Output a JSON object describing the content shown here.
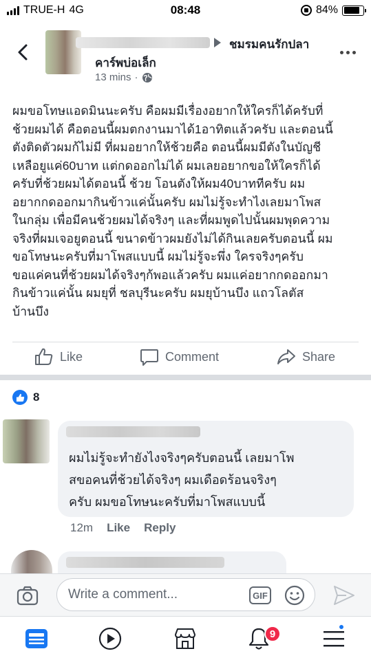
{
  "status_bar": {
    "carrier": "TRUE-H",
    "network": "4G",
    "time": "08:48",
    "battery": "84%",
    "battery_level": 0.84
  },
  "header": {
    "group_name_line1": "ชมรมคนรักปลา",
    "group_name_line2": "คาร์พบ่อเล็ก",
    "timestamp": "13 mins",
    "separator": "·",
    "audience_icon": "globe-icon",
    "back_icon": "chevron-left-icon",
    "more_icon": "more-horizontal-icon"
  },
  "post": {
    "text": "ผมขอโทษแอดมินนะครับ คือผมมีเรื่องอยากให้ใครก็ได้ครับที่\nช้วยผมได้ คือตอนนี้ผมตกงานมาได้1อาทิตแล้วครับ และตอนนี้\nตังติดตัวผมก้ไม่มี ที่ผมอยากให้ช้วยคือ ตอนนี้ผมมีตังในบัญชี\nเหลือยูแค่60บาท แต่กดออกไม่ได้ ผมเลยอยากขอให้ใครก็ได้\nครับที่ช้วยผมได้ตอนนี้ ช้วย โอนตังให้ผม40บาททีครับ ผม\nอยากกดออกมากินข้าวแค่นั้นครับ ผมไม่รู้จะทำไงเลยมาโพส\nในกลุ่ม เพื่อมีคนช้วยผมได้จริงๆ และที่ผมพูดไปนั้นผมพุดความ\nจริงที่ผมเจอยูตอนนี้ ขนาดข้าวผมยังไม่ได้กินเลยครับตอนนี้ ผม\nขอโทษนะครับที่มาโพสแบบนี้ ผมไม่รู้จะพึ่ง ใครจริงๆครับ\nขอแค่คนที่ช้วยผมได้จริงๆก้พอแล้วครับ ผมแค่อยากกดออกมา\nกินข้าวแค่นั้น ผมยุที่ ชลบุรีนะครับ ผมยุบ้านบึง แถวโลตัส\nบ้านบึง"
  },
  "actions": {
    "like_label": "Like",
    "comment_label": "Comment",
    "share_label": "Share"
  },
  "reactions": {
    "count": "8",
    "icon": "like-reaction-icon"
  },
  "comment": {
    "text": "ผมไม่รู้จะทำยังไงจริงๆครับตอนนี้ เลยมาโพ\nสขอคนที่ช้วยได้จริงๆ ผมเดือดร้อนจริงๆ\nครับ ผมขอโทษนะครับที่มาโพสแบบนี้",
    "time": "12m",
    "like_label": "Like",
    "reply_label": "Reply"
  },
  "composer": {
    "placeholder": "Write a comment...",
    "gif_label": "GIF"
  },
  "bottom_nav": {
    "notification_badge": "9",
    "items": [
      "news-feed-icon",
      "watch-icon",
      "marketplace-icon",
      "notifications-icon",
      "menu-icon"
    ]
  },
  "colors": {
    "accent": "#1877f2",
    "text_primary": "#1d2129",
    "text_secondary": "#606770",
    "bubble_bg": "#f0f2f5",
    "badge_red": "#f02849"
  }
}
